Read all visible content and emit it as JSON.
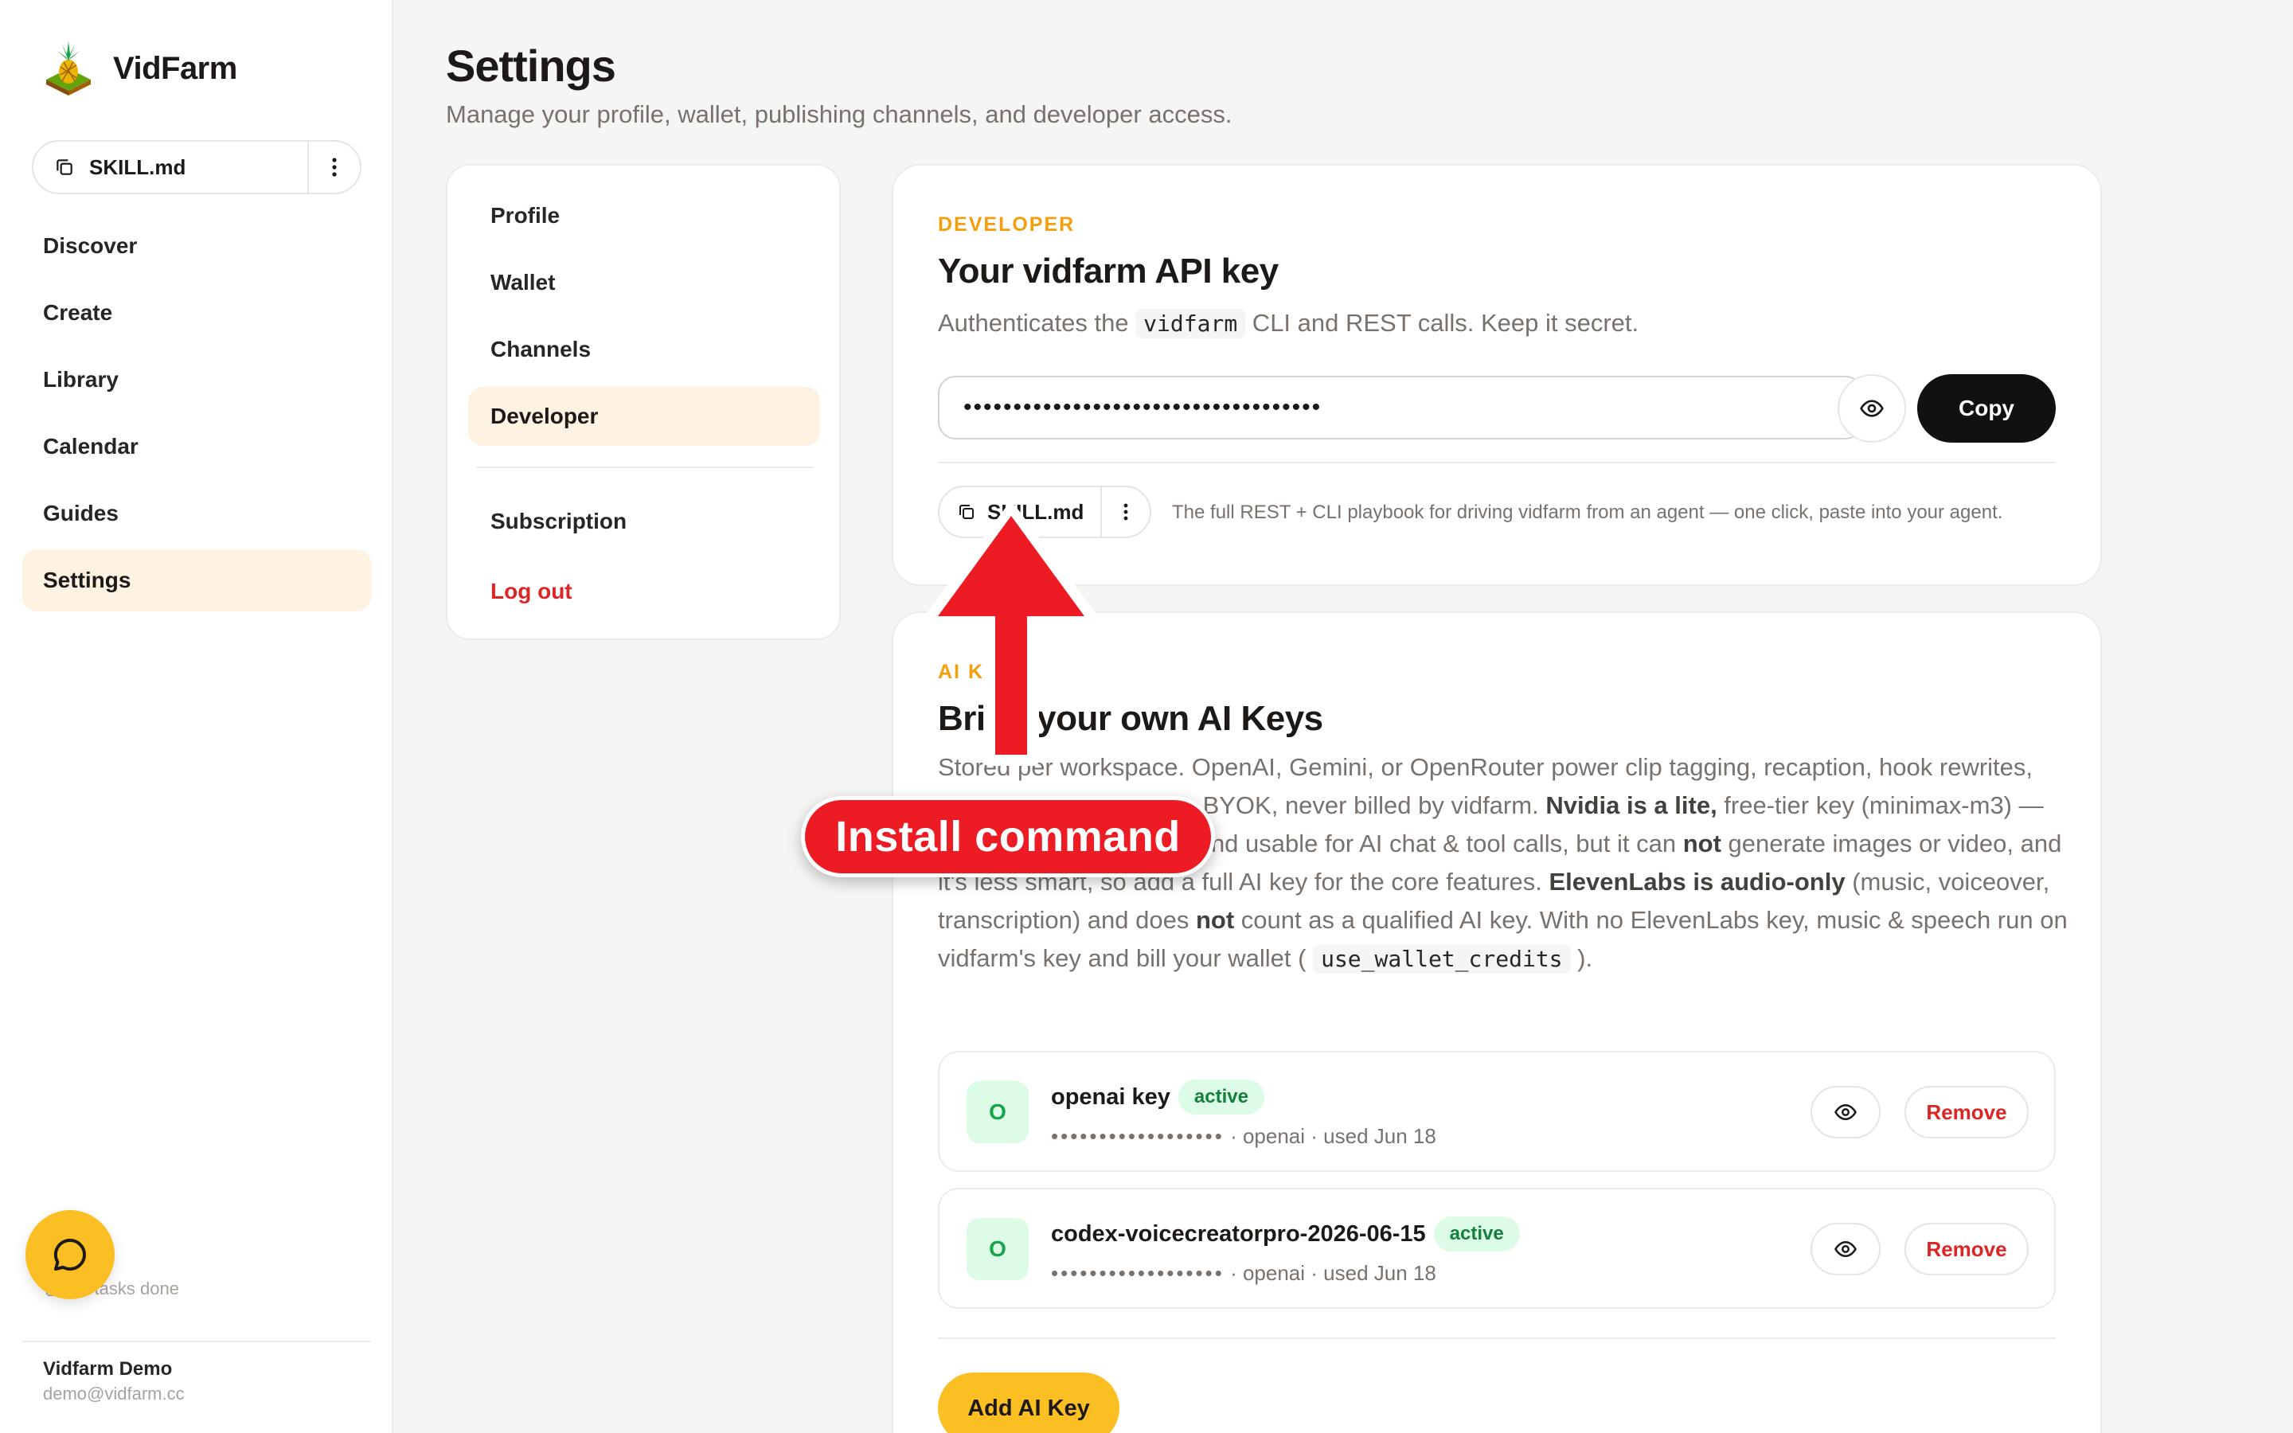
{
  "brand": {
    "name": "VidFarm"
  },
  "sidebar": {
    "skill_label": "SKILL.md",
    "nav": [
      {
        "label": "Discover"
      },
      {
        "label": "Create"
      },
      {
        "label": "Library"
      },
      {
        "label": "Calendar"
      },
      {
        "label": "Guides"
      },
      {
        "label": "Settings",
        "active": true
      }
    ],
    "tasks_status": "All tasks done",
    "user_name": "Vidfarm Demo",
    "user_email": "demo@vidfarm.cc"
  },
  "page": {
    "title": "Settings",
    "subtitle": "Manage your profile, wallet, publishing channels, and developer access."
  },
  "settings_nav": {
    "items": [
      "Profile",
      "Wallet",
      "Channels",
      "Developer",
      "Subscription",
      "Log out"
    ],
    "active": "Developer"
  },
  "developer": {
    "eyebrow": "DEVELOPER",
    "title": "Your vidfarm API key",
    "desc_before": "Authenticates the ",
    "desc_code": "vidfarm",
    "desc_after": " CLI and REST calls. Keep it secret.",
    "masked_key": "••••••••••••••••••••••••••••••••••••",
    "copy_label": "Copy",
    "skill_label": "SKILL.md",
    "skill_hint": "The full REST + CLI playbook for driving vidfarm from an agent — one click, paste into your agent."
  },
  "ai_keys": {
    "eyebrow": "AI KEYS",
    "title": "Bring your own AI Keys",
    "desc": {
      "p1": "Stored per workspace. OpenAI, Gemini, or OpenRouter power clip tagging, recaption, hook rewrites, narration, and Swipe — BYOK, never billed by vidfarm. ",
      "b1": "Nvidia is a lite,",
      "p2": " free-tier key (minimax-m3) — great for AI clip hunting and usable for AI chat & tool calls, but it can ",
      "b2": "not",
      "p3": " generate images or video, and it's less smart, so add a full AI key for the core features. ",
      "b3": "ElevenLabs is audio-only",
      "p4": " (music, voiceover, transcription) and does ",
      "b4": "not",
      "p5": " count as a qualified AI key. With no ElevenLabs key, music & speech run on vidfarm's key and bill your wallet ( ",
      "code": "use_wallet_credits",
      "p6": " )."
    },
    "keys": [
      {
        "avatar": "O",
        "name": "openai key",
        "status": "active",
        "masked": "••••••••••••••••••",
        "meta": " · openai · used Jun 18",
        "remove": "Remove"
      },
      {
        "avatar": "O",
        "name": "codex-voicecreatorpro-2026-06-15",
        "status": "active",
        "masked": "••••••••••••••••••",
        "meta": " · openai · used Jun 18",
        "remove": "Remove"
      }
    ],
    "add_label": "Add AI Key"
  },
  "annotation": {
    "label": "Install command",
    "color": "#ed1c24"
  },
  "colors": {
    "accent": "#fbbf24",
    "eyebrow": "#f59e0b",
    "active_bg": "#fef3e2",
    "danger": "#dc2626",
    "success": "#16a34a"
  }
}
